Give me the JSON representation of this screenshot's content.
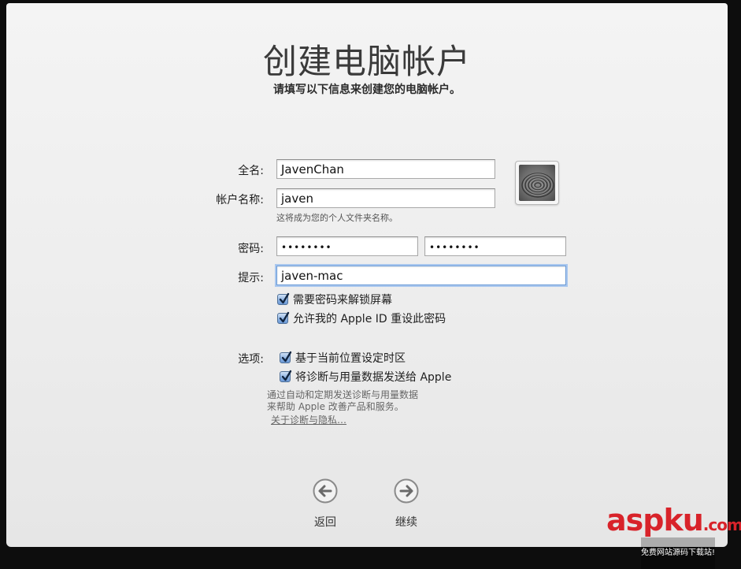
{
  "header": {
    "title": "创建电脑帐户",
    "subtitle": "请填写以下信息来创建您的电脑帐户。"
  },
  "form": {
    "full_name_label": "全名:",
    "full_name_value": "JavenChan",
    "account_name_label": "帐户名称:",
    "account_name_value": "javen",
    "account_name_hint": "这将成为您的个人文件夹名称。",
    "password_label": "密码:",
    "password_value": "••••••••",
    "verify_value": "••••••••",
    "hint_label": "提示:",
    "hint_value": "javen-mac",
    "checkbox_require_password": "需要密码来解锁屏幕",
    "checkbox_allow_apple_id": "允许我的 Apple ID 重设此密码",
    "options_label": "选项:",
    "checkbox_time_zone": "基于当前位置设定时区",
    "checkbox_send_diagnostics": "将诊断与用量数据发送给 Apple",
    "diagnostics_note_line1": "通过自动和定期发送诊断与用量数据",
    "diagnostics_note_line2": "来帮助 Apple 改善产品和服务。",
    "privacy_link": "关于诊断与隐私…"
  },
  "navigation": {
    "back_label": "返回",
    "continue_label": "继续"
  },
  "watermark": {
    "text_red": "aspku",
    "text_suffix": ".com",
    "sub": "免费网站源码下载站!"
  },
  "colors": {
    "accent_focus": "#6c9cd8",
    "checkbox_blue": "#8fb4e3",
    "watermark_red": "#d8232a"
  },
  "icons": {
    "avatar": "zen-sand-spiral-picture",
    "back": "arrow-left-circle-icon",
    "continue": "arrow-right-circle-icon",
    "check": "checkmark-icon"
  }
}
